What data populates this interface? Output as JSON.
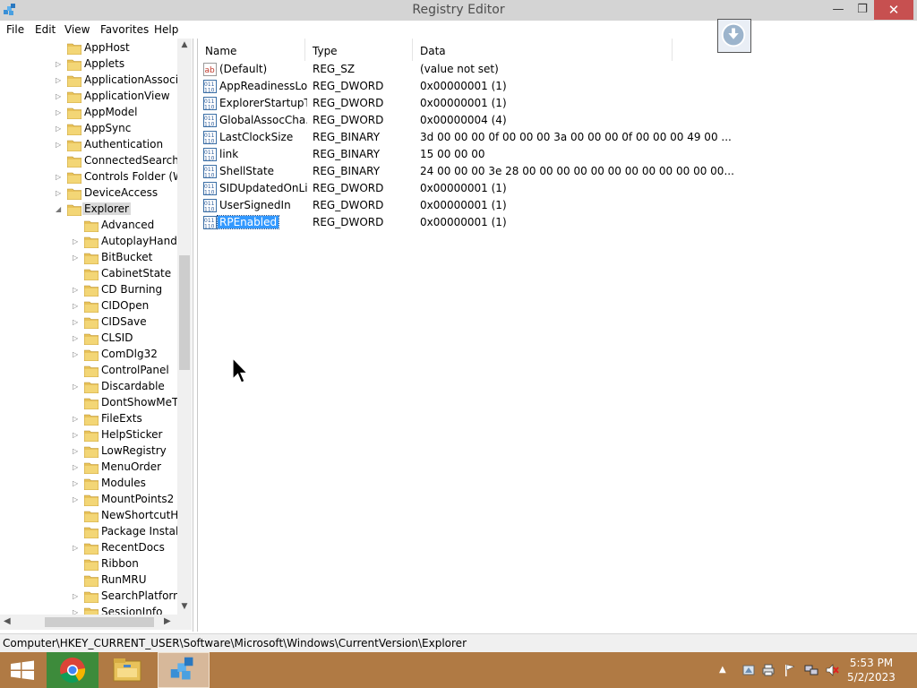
{
  "window": {
    "title": "Registry Editor"
  },
  "menu": [
    "File",
    "Edit",
    "View",
    "Favorites",
    "Help"
  ],
  "tree": {
    "items": [
      {
        "label": "AppHost",
        "expander": ""
      },
      {
        "label": "Applets",
        "expander": "▷"
      },
      {
        "label": "ApplicationAssocia",
        "expander": "▷"
      },
      {
        "label": "ApplicationView",
        "expander": "▷"
      },
      {
        "label": "AppModel",
        "expander": "▷"
      },
      {
        "label": "AppSync",
        "expander": "▷"
      },
      {
        "label": "Authentication",
        "expander": "▷"
      },
      {
        "label": "ConnectedSearch",
        "expander": ""
      },
      {
        "label": "Controls Folder (Wo",
        "expander": "▷"
      },
      {
        "label": "DeviceAccess",
        "expander": "▷"
      },
      {
        "label": "Explorer",
        "expander": "◢",
        "selected": true
      }
    ],
    "children": [
      {
        "label": "Advanced",
        "expander": ""
      },
      {
        "label": "AutoplayHandle",
        "expander": "▷"
      },
      {
        "label": "BitBucket",
        "expander": "▷"
      },
      {
        "label": "CabinetState",
        "expander": ""
      },
      {
        "label": "CD Burning",
        "expander": "▷"
      },
      {
        "label": "CIDOpen",
        "expander": "▷"
      },
      {
        "label": "CIDSave",
        "expander": "▷"
      },
      {
        "label": "CLSID",
        "expander": "▷"
      },
      {
        "label": "ComDlg32",
        "expander": "▷"
      },
      {
        "label": "ControlPanel",
        "expander": ""
      },
      {
        "label": "Discardable",
        "expander": "▷"
      },
      {
        "label": "DontShowMeTh",
        "expander": ""
      },
      {
        "label": "FileExts",
        "expander": "▷"
      },
      {
        "label": "HelpSticker",
        "expander": "▷"
      },
      {
        "label": "LowRegistry",
        "expander": "▷"
      },
      {
        "label": "MenuOrder",
        "expander": "▷"
      },
      {
        "label": "Modules",
        "expander": "▷"
      },
      {
        "label": "MountPoints2",
        "expander": "▷"
      },
      {
        "label": "NewShortcutHa",
        "expander": ""
      },
      {
        "label": "Package Installa",
        "expander": ""
      },
      {
        "label": "RecentDocs",
        "expander": "▷"
      },
      {
        "label": "Ribbon",
        "expander": ""
      },
      {
        "label": "RunMRU",
        "expander": ""
      },
      {
        "label": "SearchPlatform",
        "expander": "▷"
      },
      {
        "label": "SessionInfo",
        "expander": "▷"
      }
    ]
  },
  "list": {
    "columns": {
      "name": "Name",
      "type": "Type",
      "data": "Data"
    },
    "rows": [
      {
        "name": "(Default)",
        "type": "REG_SZ",
        "data": "(value not set)",
        "icon": "string-value-icon"
      },
      {
        "name": "AppReadinessLo...",
        "type": "REG_DWORD",
        "data": "0x00000001 (1)",
        "icon": "binary-value-icon"
      },
      {
        "name": "ExplorerStartupT...",
        "type": "REG_DWORD",
        "data": "0x00000001 (1)",
        "icon": "binary-value-icon"
      },
      {
        "name": "GlobalAssocCha...",
        "type": "REG_DWORD",
        "data": "0x00000004 (4)",
        "icon": "binary-value-icon"
      },
      {
        "name": "LastClockSize",
        "type": "REG_BINARY",
        "data": "3d 00 00 00 0f 00 00 00 3a 00 00 00 0f 00 00 00 49 00 ...",
        "icon": "binary-value-icon"
      },
      {
        "name": "link",
        "type": "REG_BINARY",
        "data": "15 00 00 00",
        "icon": "binary-value-icon"
      },
      {
        "name": "ShellState",
        "type": "REG_BINARY",
        "data": "24 00 00 00 3e 28 00 00 00 00 00 00 00 00 00 00 00 00...",
        "icon": "binary-value-icon"
      },
      {
        "name": "SIDUpdatedOnLi...",
        "type": "REG_DWORD",
        "data": "0x00000001 (1)",
        "icon": "binary-value-icon"
      },
      {
        "name": "UserSignedIn",
        "type": "REG_DWORD",
        "data": "0x00000001 (1)",
        "icon": "binary-value-icon"
      },
      {
        "name": "RPEnabled",
        "type": "REG_DWORD",
        "data": "0x00000001 (1)",
        "icon": "binary-value-icon",
        "selected": true
      }
    ]
  },
  "statusbar": {
    "path": "Computer\\HKEY_CURRENT_USER\\Software\\Microsoft\\Windows\\CurrentVersion\\Explorer"
  },
  "taskbar": {
    "time": "5:53 PM",
    "date": "5/2/2023",
    "apps": [
      "start-icon",
      "chrome-icon",
      "file-explorer-icon",
      "registry-editor-icon"
    ]
  },
  "colors": {
    "selection": "#3399ff",
    "close_button": "#c75050",
    "taskbar": "#b07a44",
    "folder": "#e8c25a"
  }
}
